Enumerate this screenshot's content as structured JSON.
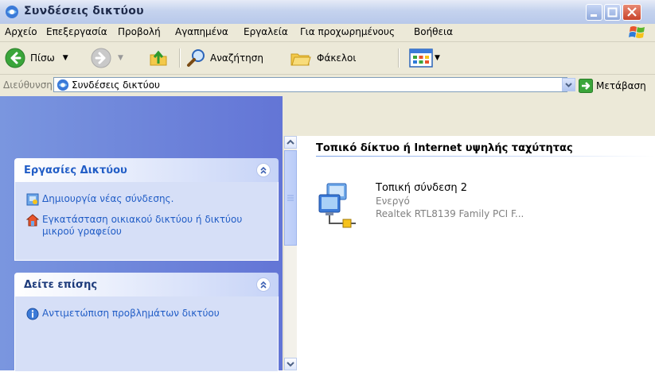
{
  "window": {
    "title": "Συνδέσεις δικτύου"
  },
  "menu": {
    "items": [
      "Αρχείο",
      "Επεξεργασία",
      "Προβολή",
      "Αγαπημένα",
      "Εργαλεία",
      "Για προχωρημένους",
      "Βοήθεια"
    ]
  },
  "toolbar": {
    "back_label": "Πίσω",
    "search_label": "Αναζήτηση",
    "folders_label": "Φάκελοι"
  },
  "address": {
    "label": "Διεύθυνση",
    "value": "Συνδέσεις δικτύου",
    "go_label": "Μετάβαση"
  },
  "left": {
    "tasks_panel": {
      "title": "Εργασίες Δικτύου",
      "items": [
        "Δημιουργία νέας σύνδεσης.",
        "Εγκατάσταση οικιακού δικτύου ή δικτύου μικρού γραφείου"
      ]
    },
    "see_also_panel": {
      "title": "Δείτε επίσης",
      "items": [
        "Αντιμετώπιση προβλημάτων δικτύου"
      ]
    }
  },
  "main": {
    "group_header": "Τοπικό δίκτυο ή Internet υψηλής ταχύτητας",
    "connection": {
      "name": "Τοπική σύνδεση 2",
      "status": "Ενεργό",
      "device": "Realtek RTL8139 Family PCI F..."
    }
  },
  "colors": {
    "accent": "#215dc6",
    "title_bar": "#c5d3ee",
    "task_pane": "#6375d6"
  }
}
